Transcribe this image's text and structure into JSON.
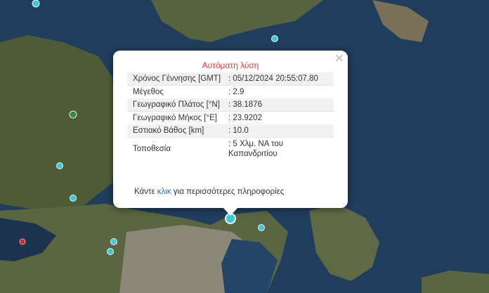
{
  "popup": {
    "title": "Αυτόματη λύση",
    "close_symbol": "×",
    "rows": [
      {
        "label": "Χρόνος Γέννησης [GMT]",
        "value": ": 05/12/2024 20:55:07.80"
      },
      {
        "label": "Μέγεθος",
        "value": ": 2.9"
      },
      {
        "label": "Γεωγραφικό Πλάτος [°N]",
        "value": ": 38.1876"
      },
      {
        "label": "Γεωγραφικό Μήκος [°E]",
        "value": ": 23.9202"
      },
      {
        "label": "Εστιακό Βάθος [km]",
        "value": ": 10.0"
      },
      {
        "label": "Τοποθεσία",
        "value": ": 5 Χλμ. ΝΑ του Καπανδριτίου"
      }
    ],
    "more_prefix": "Κάντε ",
    "more_link": "κλικ",
    "more_suffix": " για περισσότερες πληροφορίες"
  },
  "colors": {
    "sea": "#1f3d5c",
    "land": "#4a5a38",
    "marker_cyan": "#3fc9d8",
    "marker_green": "#2e8b3a",
    "marker_red": "#d12b2b",
    "title_red": "#e03b3b",
    "link_blue": "#1f78b4"
  },
  "icons": [
    "close-icon",
    "earthquake-marker"
  ]
}
